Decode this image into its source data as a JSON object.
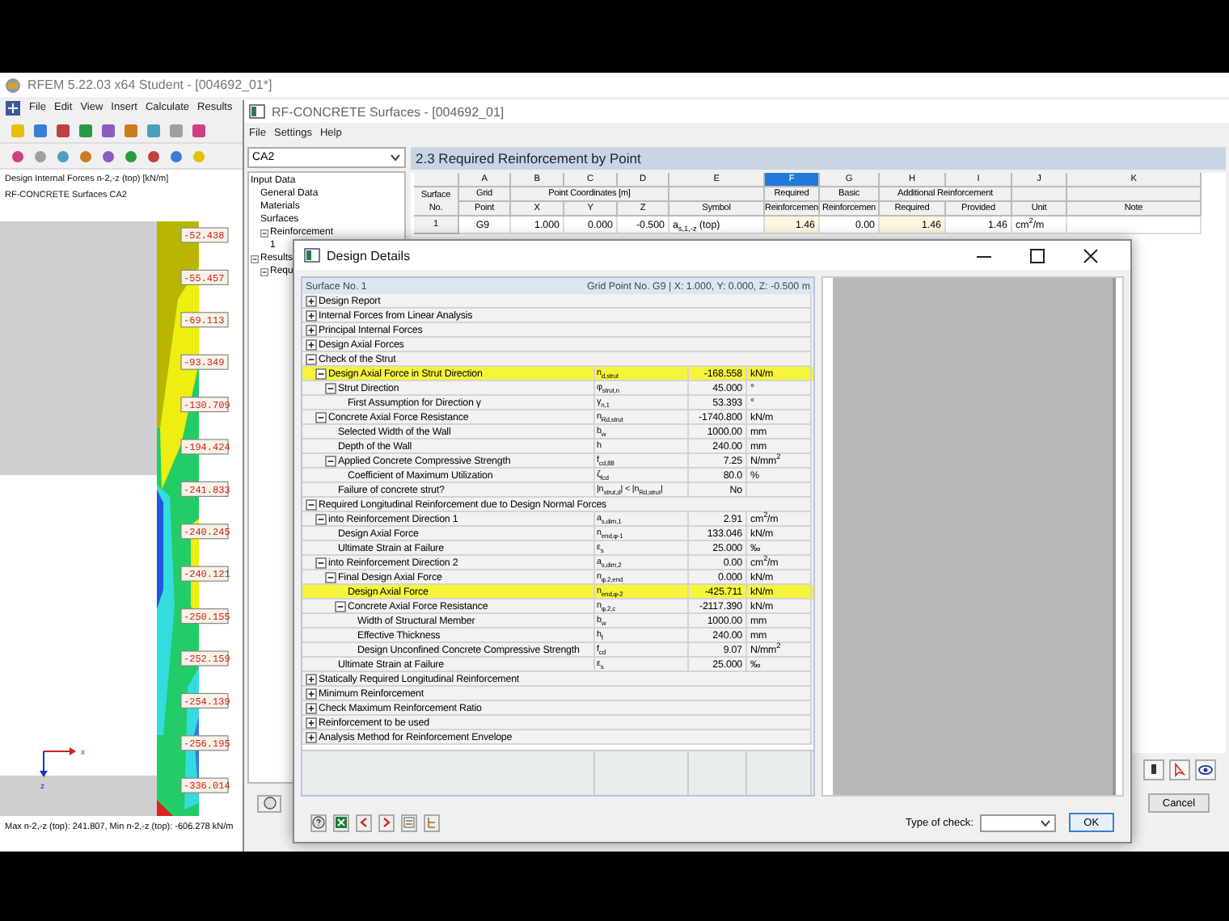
{
  "main_window": {
    "title": "RFEM 5.22.03 x64 Student - [004692_01*]",
    "menu": [
      "File",
      "Edit",
      "View",
      "Insert",
      "Calculate",
      "Results"
    ]
  },
  "graphic": {
    "title_lines": [
      "Design Internal Forces n-2,-z (top) [kN/m]",
      "RF-CONCRETE Surfaces CA2"
    ],
    "value_labels": [
      "-52.438",
      "-55.457",
      "-69.113",
      "-93.349",
      "-130.709",
      "-194.424",
      "-241.833",
      "-240.245",
      "-240.121",
      "-250.155",
      "-252.159",
      "-254.139",
      "-256.195",
      "-336.014"
    ],
    "axes": [
      "x",
      "z"
    ],
    "footer": "Max n-2,-z (top): 241.807, Min n-2,-z (top): -606.278 kN/m"
  },
  "module_window": {
    "title": "RF-CONCRETE Surfaces - [004692_01]",
    "menu": [
      "File",
      "Settings",
      "Help"
    ],
    "case_combo": "CA2",
    "navigator": [
      {
        "label": "Input Data",
        "children": [
          {
            "label": "General Data"
          },
          {
            "label": "Materials"
          },
          {
            "label": "Surfaces"
          },
          {
            "label": "Reinforcement",
            "expanded": true,
            "children": [
              {
                "label": "1"
              }
            ]
          }
        ]
      },
      {
        "label": "Results",
        "expanded": true,
        "children": [
          {
            "label": "Requ",
            "expanded": true
          }
        ]
      }
    ],
    "table": {
      "heading": "2.3 Required Reinforcement by Point",
      "row_header": "Surface No.",
      "columns": [
        {
          "letter": "A",
          "top": "Grid",
          "bottom": "Point",
          "selected": false,
          "shaded": false
        },
        {
          "letter": "B",
          "top": "Point Coordinates [m]",
          "bottom": "X",
          "selected": false,
          "shaded": false
        },
        {
          "letter": "C",
          "bottom": "Y",
          "selected": false,
          "shaded": false,
          "continues_group": true
        },
        {
          "letter": "D",
          "bottom": "Z",
          "selected": false,
          "shaded": false,
          "continues_group": true
        },
        {
          "letter": "E",
          "bottom": "Symbol",
          "selected": false,
          "shaded": false,
          "continues_group": false
        },
        {
          "letter": "F",
          "top": "Required",
          "bottom": "Reinforcemen",
          "selected": true,
          "shaded": true,
          "continues_group": false
        },
        {
          "letter": "G",
          "top": "Basic",
          "bottom": "Reinforcemen",
          "selected": false,
          "shaded": false,
          "continues_group": false
        },
        {
          "letter": "H",
          "top": "Additional Reinforcement",
          "bottom": "Required",
          "selected": false,
          "shaded": true
        },
        {
          "letter": "I",
          "bottom": "Provided",
          "selected": false,
          "shaded": false,
          "continues_group": true
        },
        {
          "letter": "J",
          "bottom": "Unit",
          "selected": false,
          "shaded": false,
          "continues_group": false
        },
        {
          "letter": "K",
          "bottom": "Note",
          "selected": false,
          "shaded": false,
          "continues_group": false
        }
      ],
      "rows": [
        {
          "number": "1",
          "cells": [
            "G9",
            "1.000",
            "0.000",
            "-0.500",
            "a$_{s,1,-z}$ (top)",
            "1.46",
            "0.00",
            "1.46",
            "1.46",
            "cm$^{2}$/m",
            ""
          ]
        }
      ]
    },
    "cancel_button": "Cancel"
  },
  "dialog": {
    "title": "Design Details",
    "surface": "Surface No. 1",
    "point": "Grid Point No. G9 | X: 1.000, Y: 0.000, Z: -0.500 m",
    "rows": [
      {
        "label": "Design Report",
        "expanded": false
      },
      {
        "label": "Internal Forces from Linear Analysis",
        "expanded": false
      },
      {
        "label": "Principal Internal Forces",
        "expanded": false
      },
      {
        "label": "Design Axial Forces",
        "expanded": false
      },
      {
        "label": "Check of the Strut",
        "expanded": true,
        "children": [
          {
            "label": "Design Axial Force in Strut Direction",
            "symbol": "n$_{d,strut}$",
            "value": "-168.558",
            "unit": "kN/m",
            "highlighted": true,
            "expanded": true,
            "children": [
              {
                "label": "Strut Direction",
                "symbol": "φ$_{strut,n}$",
                "value": "45.000",
                "unit": "°",
                "highlighted": false,
                "expanded": true,
                "children": [
                  {
                    "label": "First Assumption for Direction γ",
                    "symbol": "γ$_{n,1}$",
                    "value": "53.393",
                    "unit": "°",
                    "highlighted": false
                  }
                ]
              }
            ]
          },
          {
            "label": "Concrete Axial Force Resistance",
            "symbol": "n$_{Rd,strut}$",
            "value": "-1740.800",
            "unit": "kN/m",
            "highlighted": false,
            "expanded": true,
            "children": [
              {
                "label": "Selected Width of the Wall",
                "symbol": "b$_{w}$",
                "value": "1000.00",
                "unit": "mm",
                "highlighted": false
              },
              {
                "label": "Depth of the Wall",
                "symbol": "h",
                "value": "240.00",
                "unit": "mm",
                "highlighted": false
              },
              {
                "label": "Applied Concrete Compressive Strength",
                "symbol": "f$_{cd,88}$",
                "value": "7.25",
                "unit": "N/mm$^{2}$",
                "highlighted": false,
                "expanded": true,
                "children": [
                  {
                    "label": "Coefficient of Maximum Utilization",
                    "symbol": "ζ$_{fcd}$",
                    "value": "80.0",
                    "unit": "%",
                    "highlighted": false
                  }
                ]
              },
              {
                "label": "Failure of concrete strut?",
                "symbol": "|n$_{strut,d}$| < |n$_{Rd,strut}$|",
                "value": "No",
                "highlighted": false
              }
            ]
          }
        ]
      },
      {
        "label": "Required Longitudinal Reinforcement due to Design Normal Forces",
        "expanded": true,
        "children": [
          {
            "label": "into Reinforcement Direction 1",
            "symbol": "a$_{s,dim,1}$",
            "value": "2.91",
            "unit": "cm$^{2}$/m",
            "highlighted": false,
            "expanded": true,
            "children": [
              {
                "label": "Design Axial Force",
                "symbol": "n$_{end,φ-1}$",
                "value": "133.046",
                "unit": "kN/m",
                "highlighted": false
              },
              {
                "label": "Ultimate Strain at Failure",
                "symbol": "ε$_{s}$",
                "value": "25.000",
                "unit": "‰",
                "highlighted": false
              }
            ]
          },
          {
            "label": "into Reinforcement Direction 2",
            "symbol": "a$_{s,dim,2}$",
            "value": "0.00",
            "unit": "cm$^{2}$/m",
            "highlighted": false,
            "expanded": true,
            "children": [
              {
                "label": "Final Design Axial Force",
                "symbol": "n$_{φ,2,end}$",
                "value": "0.000",
                "unit": "kN/m",
                "highlighted": false,
                "expanded": true,
                "children": [
                  {
                    "label": "Design Axial Force",
                    "symbol": "n$_{end,φ-2}$",
                    "value": "-425.711",
                    "unit": "kN/m",
                    "highlighted": true
                  },
                  {
                    "label": "Concrete Axial Force Resistance",
                    "symbol": "n$_{φ,2,c}$",
                    "value": "-2117.390",
                    "unit": "kN/m",
                    "highlighted": false,
                    "expanded": true,
                    "children": [
                      {
                        "label": "Width of Structural Member",
                        "symbol": "b$_{w}$",
                        "value": "1000.00",
                        "unit": "mm",
                        "highlighted": false
                      },
                      {
                        "label": "Effective Thickness",
                        "symbol": "h$_{f}$",
                        "value": "240.00",
                        "unit": "mm",
                        "highlighted": false
                      },
                      {
                        "label": "Design Unconfined Concrete Compressive Strength",
                        "symbol": "f$_{cd}$",
                        "value": "9.07",
                        "unit": "N/mm$^{2}$",
                        "highlighted": false
                      }
                    ]
                  }
                ]
              },
              {
                "label": "Ultimate Strain at Failure",
                "symbol": "ε$_{s}$",
                "value": "25.000",
                "unit": "‰",
                "highlighted": false
              }
            ]
          }
        ]
      },
      {
        "label": "Statically Required Longitudinal Reinforcement",
        "expanded": false
      },
      {
        "label": "Minimum Reinforcement",
        "expanded": false
      },
      {
        "label": "Check Maximum Reinforcement Ratio",
        "expanded": false
      },
      {
        "label": "Reinforcement to be used",
        "expanded": false
      },
      {
        "label": "Analysis Method for Reinforcement Envelope",
        "expanded": false
      }
    ],
    "check_type_label": "Type of check:",
    "ok_button": "OK"
  }
}
